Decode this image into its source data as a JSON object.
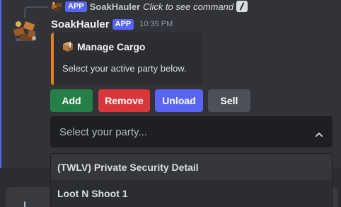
{
  "reply": {
    "app_badge": "APP",
    "username": "SoakHauler",
    "command_hint": "Click to see command"
  },
  "message": {
    "username": "SoakHauler",
    "app_badge": "APP",
    "timestamp": "10:35 PM",
    "avatar_icon": "cargo-crate-icon"
  },
  "embed": {
    "icon": "package-icon",
    "title": "Manage Cargo",
    "description": "Select your active party below.",
    "accent_color": "#e67e22"
  },
  "buttons": {
    "add": "Add",
    "remove": "Remove",
    "unload": "Unload",
    "sell": "Sell"
  },
  "select": {
    "placeholder": "Select your party...",
    "options": [
      "(TWLV) Private Security Detail",
      "Loot N Shoot 1"
    ]
  },
  "colors": {
    "blurple": "#5865f2",
    "success": "#248046",
    "danger": "#da373c",
    "secondary": "#4e5058"
  }
}
